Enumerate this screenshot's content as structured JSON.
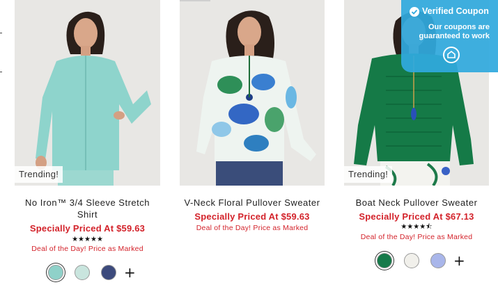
{
  "products": [
    {
      "trending_label": "Trending!",
      "name_line1": "No Iron™ 3/4 Sleeve Stretch",
      "name_line2": "Shirt",
      "price": "Specially Priced At $59.63",
      "rating_stars": 5,
      "stars_text": "★★★★★",
      "deal": "Deal of the Day! Price as Marked",
      "swatch_colors": [
        "#8fd1c9",
        "#c9e5de",
        "#3c4a7c"
      ],
      "selected_swatch": 0
    },
    {
      "name_line1": "V-Neck Floral Pullover Sweater",
      "price": "Specially Priced At $59.63",
      "deal": "Deal of the Day! Price as Marked"
    },
    {
      "trending_label": "Trending!",
      "name_line1": "Boat Neck Pullover Sweater",
      "price": "Specially Priced At $67.13",
      "rating_stars": 4.5,
      "stars_text": "★★★★⯪",
      "deal": "Deal of the Day! Price as Marked",
      "swatch_colors": [
        "#167a4a",
        "#f1f0eb",
        "#a9b6ea"
      ],
      "selected_swatch": 0
    }
  ],
  "coupon": {
    "title": "Verified Coupon",
    "line1": "Our coupons are",
    "line2": "guaranteed to work"
  },
  "icons": {
    "check": "check-circle-icon",
    "coupon": "coupon-tag-icon",
    "more_colors": "plus-icon"
  },
  "colors": {
    "price_red": "#d3222a",
    "coupon_blue": "#30a9de"
  }
}
